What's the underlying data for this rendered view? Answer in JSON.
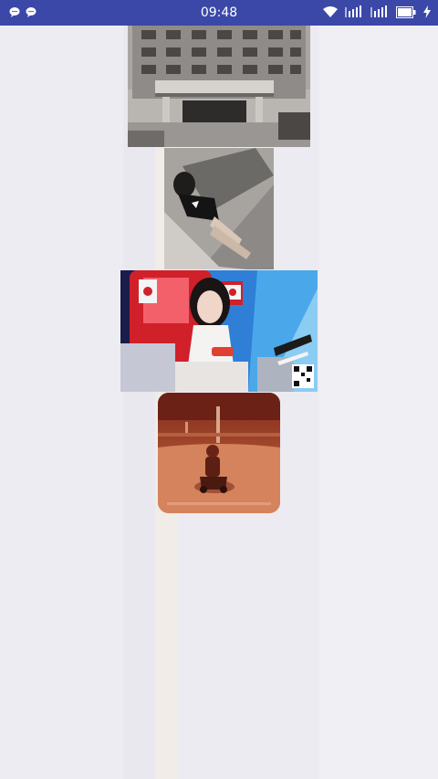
{
  "status_bar": {
    "time": "09:48",
    "background": "#3b48a8",
    "left_icons": [
      "chat-bubble-icon",
      "chat-bubble-icon"
    ],
    "right_icons": [
      "wifi-icon",
      "signal-icon",
      "signal-icon",
      "battery-icon",
      "charging-icon"
    ]
  },
  "images": [
    {
      "name": "building-photo"
    },
    {
      "name": "person-lying-photo"
    },
    {
      "name": "tv-show-singer-photo"
    },
    {
      "name": "street-robot-photo"
    }
  ]
}
